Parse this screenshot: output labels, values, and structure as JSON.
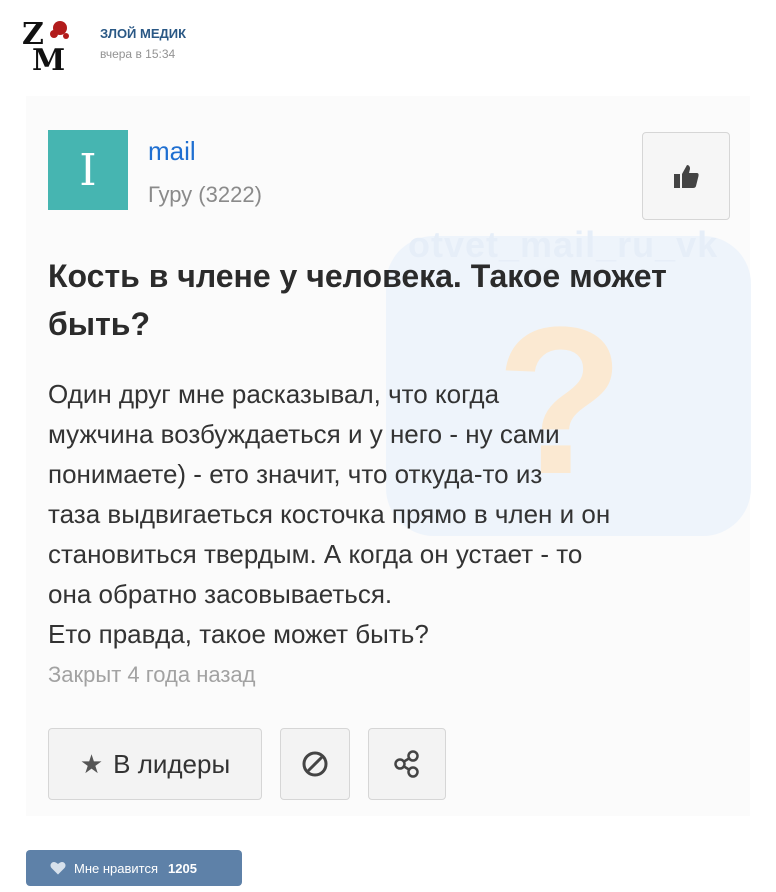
{
  "post": {
    "group_name": "ЗЛОЙ МЕДИК",
    "time": "вчера в 15:34",
    "logo_icon": "group-logo-zm"
  },
  "card": {
    "watermark": "otvet_mail_ru_vk",
    "avatar_letter": "I",
    "user_name": "mail",
    "user_rank": "Гуру (3222)",
    "question_title": "Кость в члене у человека. Такое может быть?",
    "question_body": [
      "Один друг мне расказывал, что когда",
      "мужчина возбуждаеться и у него - ну сами",
      "понимаете) - ето значит, что откуда-то из",
      "таза выдвигаеться косточка прямо в член и он",
      "становиться твердым. А когда он устает - то",
      "она обратно засовываеться.",
      "Ето правда, такое может быть?"
    ],
    "closed": "Закрыт 4 года назад",
    "leaders_label": "В лидеры",
    "colors": {
      "avatar": "#46b5b1",
      "user_link": "#1f6fd1"
    }
  },
  "likes": {
    "label": "Мне нравится",
    "count": "1205",
    "color": "#5e81a8"
  }
}
